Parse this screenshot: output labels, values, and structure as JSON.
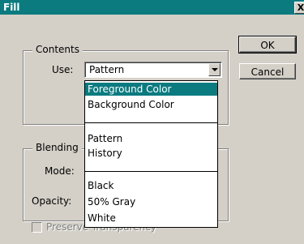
{
  "window": {
    "title": "Fill",
    "close_label": "X"
  },
  "buttons": {
    "ok": "OK",
    "cancel": "Cancel"
  },
  "contents": {
    "group_label": "Contents",
    "use_label": "Use:",
    "use_value": "Pattern",
    "options": [
      "Foreground Color",
      "Background Color",
      "Pattern",
      "History",
      "Black",
      "50% Gray",
      "White"
    ],
    "highlighted_option": "Foreground Color"
  },
  "blending": {
    "group_label": "Blending",
    "mode_label": "Mode:",
    "opacity_label": "Opacity:",
    "preserve_label": "Preserve Transparency"
  }
}
